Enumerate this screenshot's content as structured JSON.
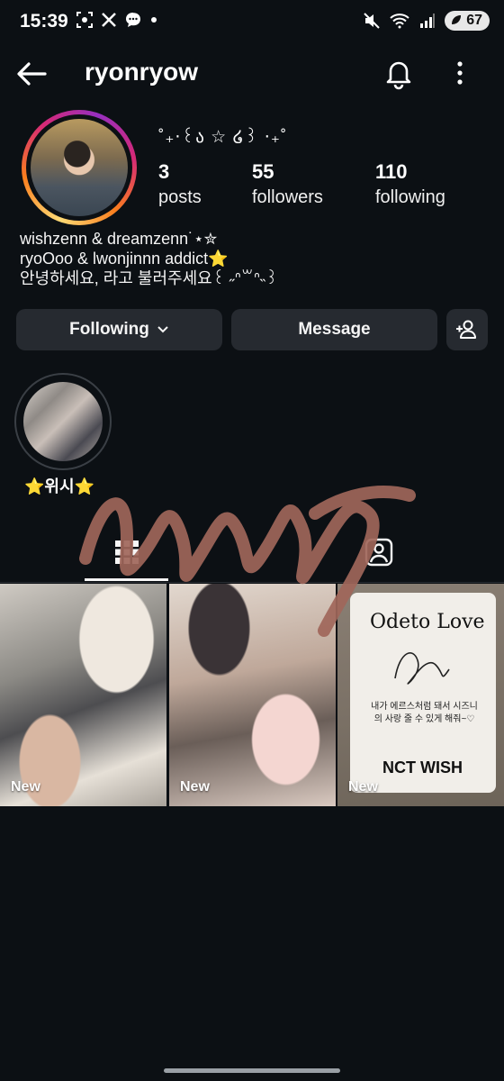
{
  "status_bar": {
    "time": "15:39",
    "battery": "67"
  },
  "header": {
    "username": "ryonryow"
  },
  "profile": {
    "display_name": "˚₊‧꒰ა ☆ ໒꒱ ‧₊˚",
    "stats": [
      {
        "value": "3",
        "label": "posts"
      },
      {
        "value": "55",
        "label": "followers"
      },
      {
        "value": "110",
        "label": "following"
      }
    ],
    "bio": [
      "wishzenn & dreamzenn˙⋆✮",
      "ryoOoo & lwonjinnn addict⭐",
      "안녕하세요, 라고 불러주세요꒰ ˶ᐢ꒳ᐢ˵꒱"
    ]
  },
  "actions": {
    "following_label": "Following",
    "message_label": "Message"
  },
  "highlights": [
    {
      "label": "⭐위시⭐"
    }
  ],
  "posts": [
    {
      "badge": "New"
    },
    {
      "badge": "New"
    },
    {
      "badge": "New",
      "card_title": "Odeto Love",
      "card_text": "내가 에르스처럼 돼서 시즈니의 사랑 줄 수 있게 해줘~♡",
      "card_brand": "NCT WISH"
    }
  ]
}
